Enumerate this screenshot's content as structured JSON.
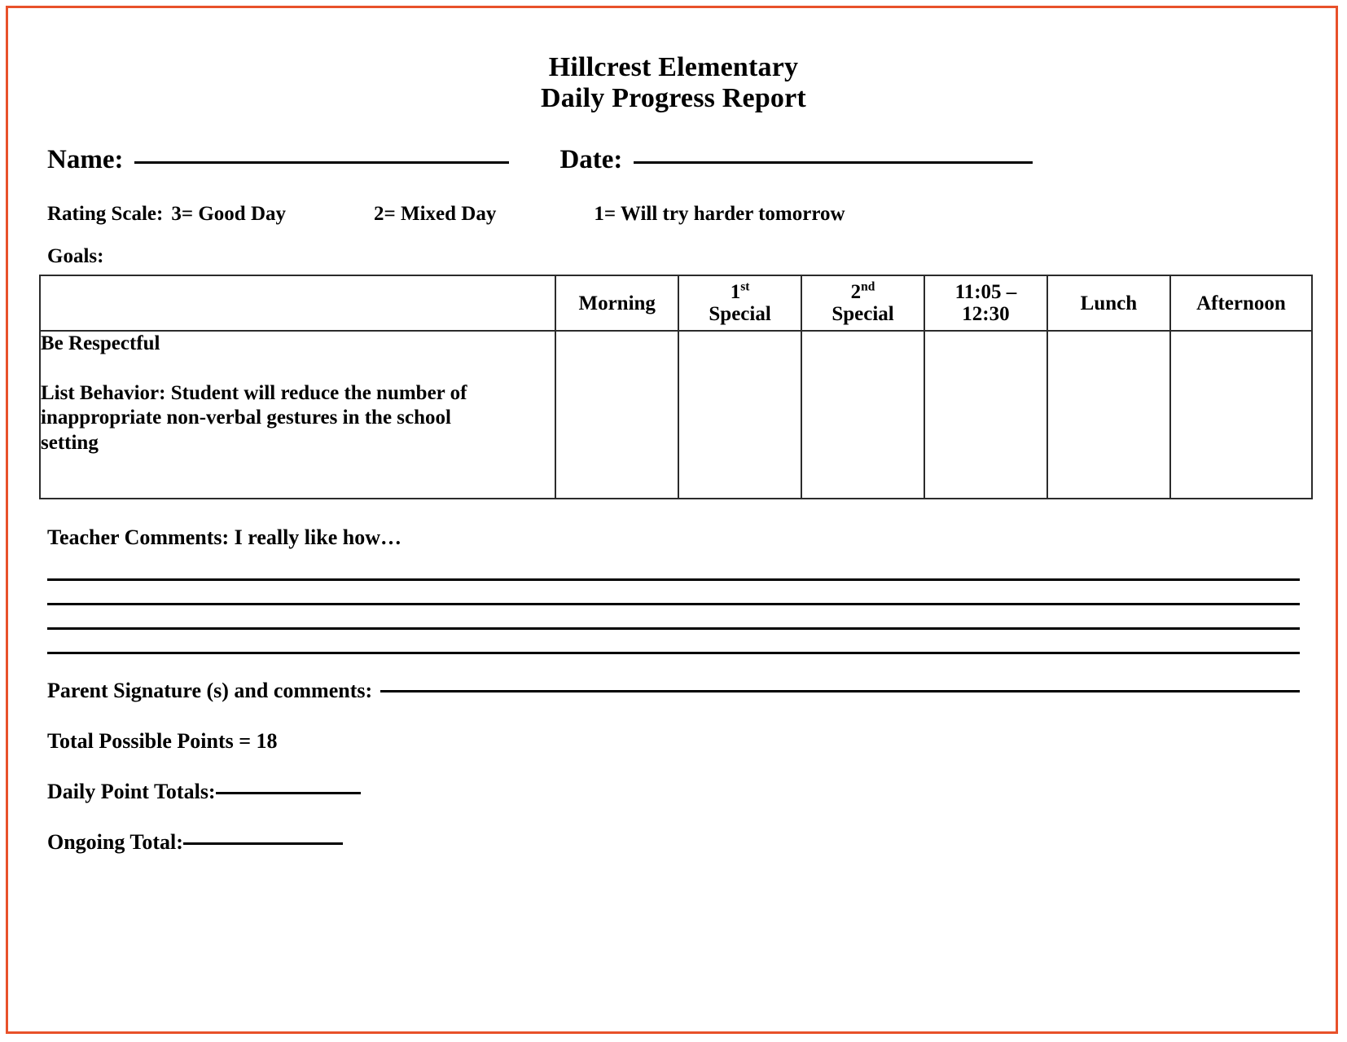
{
  "document": {
    "title_line_1": "Hillcrest Elementary",
    "title_line_2": "Daily Progress Report",
    "border_color": "#e8512a"
  },
  "identity": {
    "name_label": "Name:",
    "name_value": "",
    "date_label": "Date:",
    "date_value": ""
  },
  "rating_scale": {
    "label": "Rating Scale:",
    "options": [
      "3= Good Day",
      "2= Mixed Day",
      "1= Will try harder tomorrow"
    ]
  },
  "goals": {
    "label": "Goals:"
  },
  "table": {
    "columns": [
      {
        "key": "goal",
        "line1": "",
        "line2": ""
      },
      {
        "key": "morning",
        "line1": "",
        "line2": "Morning"
      },
      {
        "key": "first_special",
        "line1_num": "1",
        "line1_sup": "st",
        "line2": "Special"
      },
      {
        "key": "second_special",
        "line1_num": "2",
        "line1_sup": "nd",
        "line2": "Special"
      },
      {
        "key": "eleven_twelve",
        "line1": "11:05 –",
        "line2": "12:30"
      },
      {
        "key": "lunch",
        "line1": "Lunch",
        "line2": ""
      },
      {
        "key": "afternoon",
        "line1": "Afternoon",
        "line2": ""
      }
    ],
    "rows": [
      {
        "goal_title": "Be Respectful",
        "goal_behavior": "List Behavior:  Student will reduce the number of inappropriate non-verbal gestures in the school setting",
        "morning": "",
        "first_special": "",
        "second_special": "",
        "eleven_twelve": "",
        "lunch": "",
        "afternoon": ""
      }
    ]
  },
  "teacher_comments": {
    "label": "Teacher Comments:  I really like how…",
    "line_count": 4,
    "values": [
      "",
      "",
      "",
      ""
    ]
  },
  "parent_signature": {
    "label": "Parent Signature (s) and comments:",
    "value": ""
  },
  "totals": {
    "total_possible": "Total Possible Points = 18",
    "daily_label": "Daily Point Totals:",
    "daily_value": "",
    "ongoing_label": "Ongoing Total:",
    "ongoing_value": ""
  }
}
